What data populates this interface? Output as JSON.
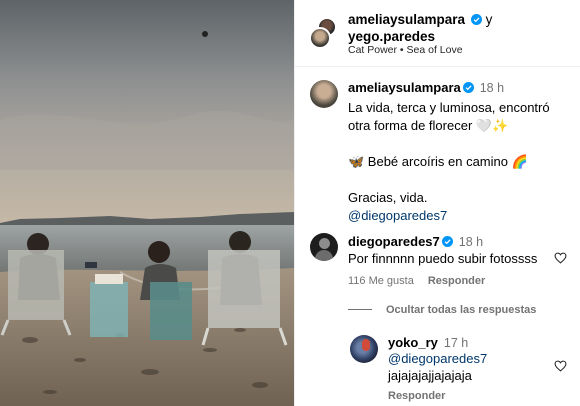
{
  "header": {
    "author1": "ameliaysulampara",
    "conjunction": "y",
    "author2": "yego.paredes",
    "music": "Cat Power • Sea of Love"
  },
  "caption": {
    "username": "ameliaysulampara",
    "time": "18 h",
    "line1": "La vida, terca y luminosa, encontró otra forma de florecer 🤍✨",
    "line2": "🦋 Bebé arcoíris en camino 🌈",
    "line3": "Gracias, vida.",
    "mention": "@diegoparedes7"
  },
  "comments": [
    {
      "username": "diegoparedes7",
      "time": "18 h",
      "text": "Por finnnnn puedo subir fotossss",
      "likes": "116 Me gusta",
      "reply_label": "Responder"
    }
  ],
  "hide_replies_label": "Ocultar todas las respuestas",
  "replies": [
    {
      "username": "yoko_ry",
      "time": "17 h",
      "mention": "@diegoparedes7",
      "text": "jajajajajjajajaja",
      "reply_label": "Responder"
    }
  ],
  "colors": {
    "verified": "#0095f6",
    "link": "#00376b",
    "secondary": "#737373"
  }
}
